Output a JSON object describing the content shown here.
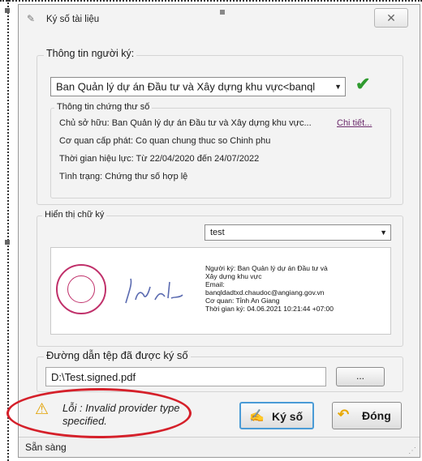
{
  "window": {
    "title": "Ký số tài liệu"
  },
  "signer_group": {
    "label": "Thông tin người ký:",
    "signer_select": "Ban Quản lý dự án Đầu tư và Xây dựng khu vực<banql",
    "cert": {
      "label": "Thông tin chứng thư số",
      "owner": "Chủ sở hữu: Ban Quản lý dự án Đầu tư và Xây dựng khu vực...",
      "details_link": "Chi tiết...",
      "issuer": "Cơ quan cấp phát: Co quan chung thuc so Chinh phu",
      "validity": "Thời gian hiệu lực: Từ 22/04/2020 đến 24/07/2022",
      "status": "Tình trạng: Chứng thư số hợp lệ"
    }
  },
  "display_group": {
    "label": "Hiển thị chữ ký",
    "style_select": "test",
    "preview": {
      "signer": "Người ký: Ban Quản lý dự án Đầu tư và",
      "signer_cont": "Xây dựng khu vực",
      "email_label": "Email:",
      "email": "banqldadtxd.chaudoc@angiang.gov.vn",
      "agency": "Cơ quan: Tỉnh An Giang",
      "time": "Thời gian ký: 04.06.2021 10:21:44 +07:00"
    }
  },
  "path_group": {
    "label": "Đường dẫn tệp đã được ký số",
    "path": "D:\\Test.signed.pdf",
    "browse": "..."
  },
  "error": {
    "line1": "Lỗi : Invalid provider type",
    "line2": "specified."
  },
  "buttons": {
    "sign": "Ký số",
    "close": "Đóng"
  },
  "status": {
    "text": "Sẵn sàng"
  }
}
